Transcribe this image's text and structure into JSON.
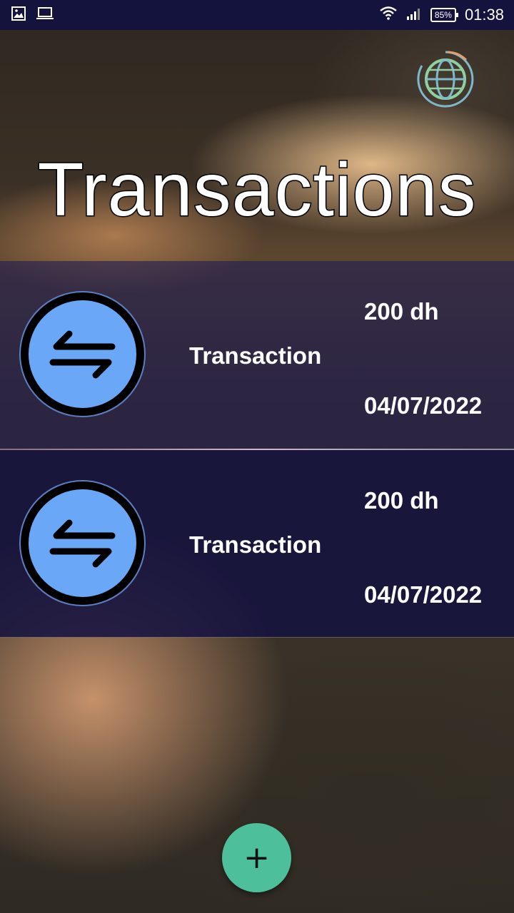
{
  "status_bar": {
    "battery": "85%",
    "time": "01:38",
    "icons": [
      "image-icon",
      "laptop-icon",
      "wifi-icon",
      "signal-icon",
      "battery-icon"
    ]
  },
  "header": {
    "title": "Transactions",
    "language_button_icon": "globe-icon"
  },
  "transactions": [
    {
      "label": "Transaction",
      "amount": "200 dh",
      "date": "04/07/2022",
      "icon": "swap-arrows-icon"
    },
    {
      "label": "Transaction",
      "amount": "200 dh",
      "date": "04/07/2022",
      "icon": "swap-arrows-icon"
    }
  ],
  "fab": {
    "label": "+",
    "icon": "plus-icon"
  },
  "colors": {
    "status_bar": "#14133d",
    "icon_fill": "#6aa8f7",
    "fab": "#4dbf9a",
    "card_1": "#221e52",
    "card_2": "#141240"
  }
}
